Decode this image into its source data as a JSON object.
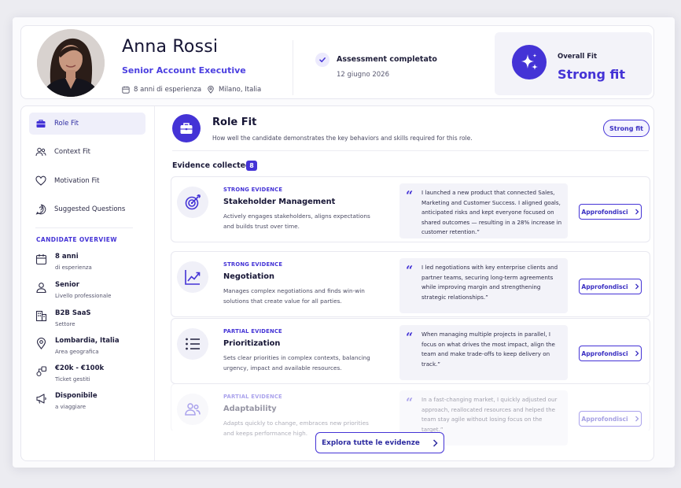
{
  "candidate": {
    "name": "Anna Rossi",
    "role": "Senior Account Executive",
    "experience": "8 anni di esperienza",
    "location": "Milano, Italia"
  },
  "assessment": {
    "status": "Assessment completato",
    "date": "12 giugno 2026"
  },
  "overall_fit": {
    "label": "Overall Fit",
    "value": "Strong fit"
  },
  "sidebar": {
    "nav": [
      {
        "label": "Role Fit",
        "icon": "briefcase-icon",
        "active": true
      },
      {
        "label": "Context Fit",
        "icon": "users-icon",
        "active": false
      },
      {
        "label": "Motivation Fit",
        "icon": "heart-icon",
        "active": false
      },
      {
        "label": "Suggested Questions",
        "icon": "question-icon",
        "active": false
      }
    ],
    "overview_title": "CANDIDATE OVERVIEW",
    "overview": [
      {
        "value": "8 anni",
        "label": "di esperienza",
        "icon": "calendar-icon"
      },
      {
        "value": "Senior",
        "label": "Livello professionale",
        "icon": "user-level-icon"
      },
      {
        "value": "B2B SaaS",
        "label": "Settore",
        "icon": "building-icon"
      },
      {
        "value": "Lombardia, Italia",
        "label": "Area geografica",
        "icon": "location-icon"
      },
      {
        "value": "€20k - €100k",
        "label": "Ticket gestiti",
        "icon": "ticket-icon"
      },
      {
        "value": "Disponibile",
        "label": "a viaggiare",
        "icon": "megaphone-icon"
      }
    ]
  },
  "main": {
    "title": "Role Fit",
    "subtitle": "How well the candidate demonstrates the key behaviors and skills required for this role.",
    "fit_pill": "Strong fit",
    "evidence_title": "Evidence collected",
    "evidence_count": "8",
    "button_label": "Approfondisci",
    "explore_label": "Explora tutte le evidenze",
    "evidence": [
      {
        "kind": "STRONG EVIDENCE",
        "name": "Stakeholder Management",
        "description": "Actively engages stakeholders, aligns expectations and builds trust over time.",
        "quote": "I launched a new product that connected Sales, Marketing and Customer Success. I aligned goals, anticipated risks and kept everyone focused on shared outcomes — resulting in a 28% increase in customer retention.”",
        "icon": "target-icon"
      },
      {
        "kind": "STRONG EVIDENCE",
        "name": "Negotiation",
        "description": "Manages complex negotiations and finds win-win solutions that create value for all parties.",
        "quote": "I led negotiations with key enterprise clients and partner teams, securing long-term agreements while improving margin and strengthening strategic relationships.”",
        "icon": "trend-up-icon"
      },
      {
        "kind": "PARTIAL EVIDENCE",
        "name": "Prioritization",
        "description": "Sets clear priorities in complex contexts, balancing urgency, impact and available resources.",
        "quote": "When managing multiple projects in parallel, I focus on what drives the most impact, align the team and make trade-offs to keep delivery on track.”",
        "icon": "list-icon"
      },
      {
        "kind": "PARTIAL EVIDENCE",
        "name": "Adaptability",
        "description": "Adapts quickly to change, embraces new priorities and keeps performance high.",
        "quote": "In a fast-changing market, I quickly adjusted our approach, reallocated resources and helped the team stay agile without losing focus on the target.”",
        "icon": "people-icon"
      }
    ]
  },
  "colors": {
    "accent": "#4433d6",
    "accent_soft": "#efeffa",
    "text": "#1c1b3a"
  }
}
